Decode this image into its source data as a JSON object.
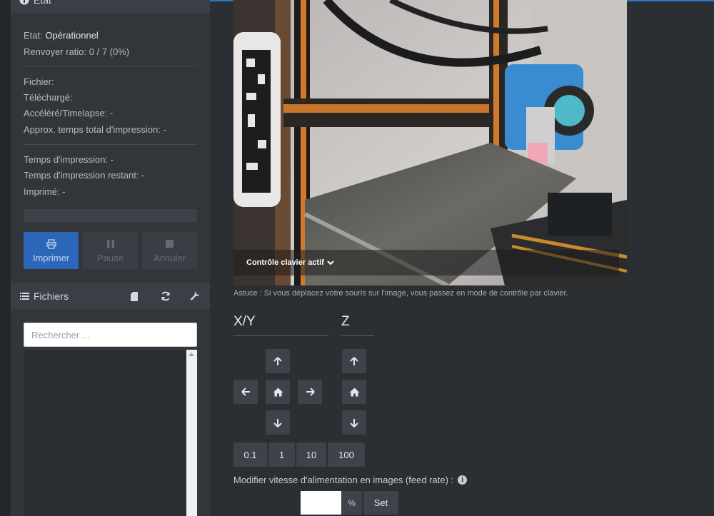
{
  "state_panel": {
    "title": "Etat",
    "state_label": "Etat:",
    "state_value": "Opérationnel",
    "resend_ratio": "Renvoyer ratio: 0 / 7 (0%)",
    "file_label": "Fichier:",
    "uploaded_label": "Téléchargé:",
    "timelapse": "Accéléré/Timelapse: -",
    "approx_total_time": "Approx. temps total d'impression: -",
    "print_time": "Temps d'impression: -",
    "print_time_left": "Temps d'impression restant: -",
    "printed": "Imprimé: -",
    "progress_percent": 0,
    "buttons": {
      "print": "Imprimer",
      "pause": "Pause",
      "cancel": "Annuler"
    }
  },
  "files_panel": {
    "title": "Fichiers",
    "search_placeholder": "Rechercher ...",
    "icons": [
      "sd-card-icon",
      "refresh-icon",
      "wrench-icon"
    ]
  },
  "webcam": {
    "keyboard_control_label": "Contrôle clavier actif",
    "hint": "Astuce : Si vous déplacez votre souris sur l'image, vous passez en mode de contrôle par clavier."
  },
  "jog": {
    "xy_title": "X/Y",
    "z_title": "Z",
    "steps": [
      "0.1",
      "1",
      "10",
      "100"
    ]
  },
  "feed_rate": {
    "label": "Modifier vitesse d'alimentation en images (feed rate) :",
    "value": "",
    "unit": "%",
    "set_label": "Set"
  },
  "colors": {
    "accent": "#2c66b8",
    "top_line": "#2f74c8",
    "sidebar": "#32363b",
    "background": "#2b2e33"
  }
}
